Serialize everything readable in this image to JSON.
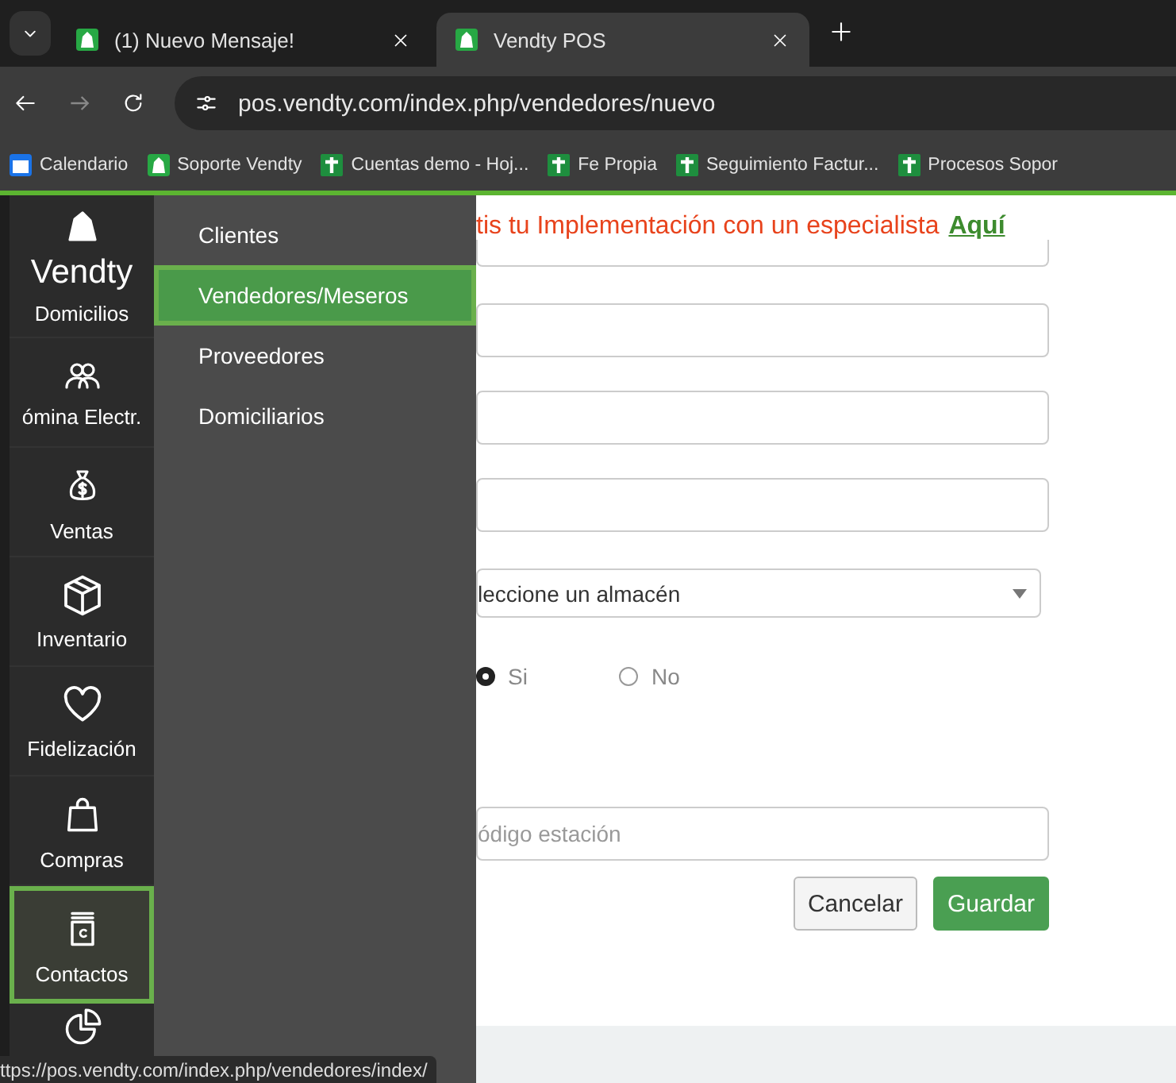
{
  "browser": {
    "tabs": [
      {
        "title": "(1) Nuevo Mensaje!",
        "selected": false
      },
      {
        "title": "Vendty POS",
        "selected": true
      }
    ],
    "address": "pos.vendty.com/index.php/vendedores/nuevo",
    "bookmarks": [
      {
        "label": "Calendario",
        "kind": "calendar"
      },
      {
        "label": "Soporte Vendty",
        "kind": "vendty"
      },
      {
        "label": "Cuentas demo - Hoj...",
        "kind": "sheet"
      },
      {
        "label": "Fe Propia",
        "kind": "sheet"
      },
      {
        "label": "Seguimiento Factur...",
        "kind": "sheet"
      },
      {
        "label": "Procesos Sopor",
        "kind": "sheet"
      }
    ]
  },
  "sidebar": {
    "brand": "Vendty",
    "items": [
      {
        "label": "Domicilios",
        "kind": "logo",
        "selected": false
      },
      {
        "label": "ómina Electr.",
        "kind": "people",
        "selected": false
      },
      {
        "label": "Ventas",
        "kind": "moneybag",
        "selected": false
      },
      {
        "label": "Inventario",
        "kind": "box",
        "selected": false
      },
      {
        "label": "Fidelización",
        "kind": "heart",
        "selected": false
      },
      {
        "label": "Compras",
        "kind": "bag",
        "selected": false
      },
      {
        "label": "Contactos",
        "kind": "book",
        "selected": true
      },
      {
        "kind": "pie",
        "selected": false
      }
    ]
  },
  "submenu": {
    "items": [
      {
        "label": "Clientes",
        "selected": false
      },
      {
        "label": "Vendedores/Meseros",
        "selected": true
      },
      {
        "label": "Proveedores",
        "selected": false
      },
      {
        "label": "Domiciliarios",
        "selected": false
      }
    ]
  },
  "banner": {
    "text": "tis tu Implementación con un especialista",
    "link": "Aquí"
  },
  "form": {
    "fields": [
      {
        "kind": "cut"
      },
      {
        "kind": "text"
      },
      {
        "kind": "text"
      },
      {
        "kind": "text"
      },
      {
        "kind": "select",
        "value": "leccione un almacén"
      },
      {
        "kind": "radio",
        "options": [
          {
            "label": "Si",
            "selected": true
          },
          {
            "label": "No",
            "selected": false
          }
        ]
      },
      {
        "kind": "text",
        "placeholder": "ódigo estación"
      }
    ],
    "buttons": [
      {
        "label": "Cancelar",
        "kind": "secondary"
      },
      {
        "label": "Guardar",
        "kind": "primary"
      }
    ]
  },
  "status_url": "ttps://pos.vendty.com/index.php/vendedores/index/"
}
